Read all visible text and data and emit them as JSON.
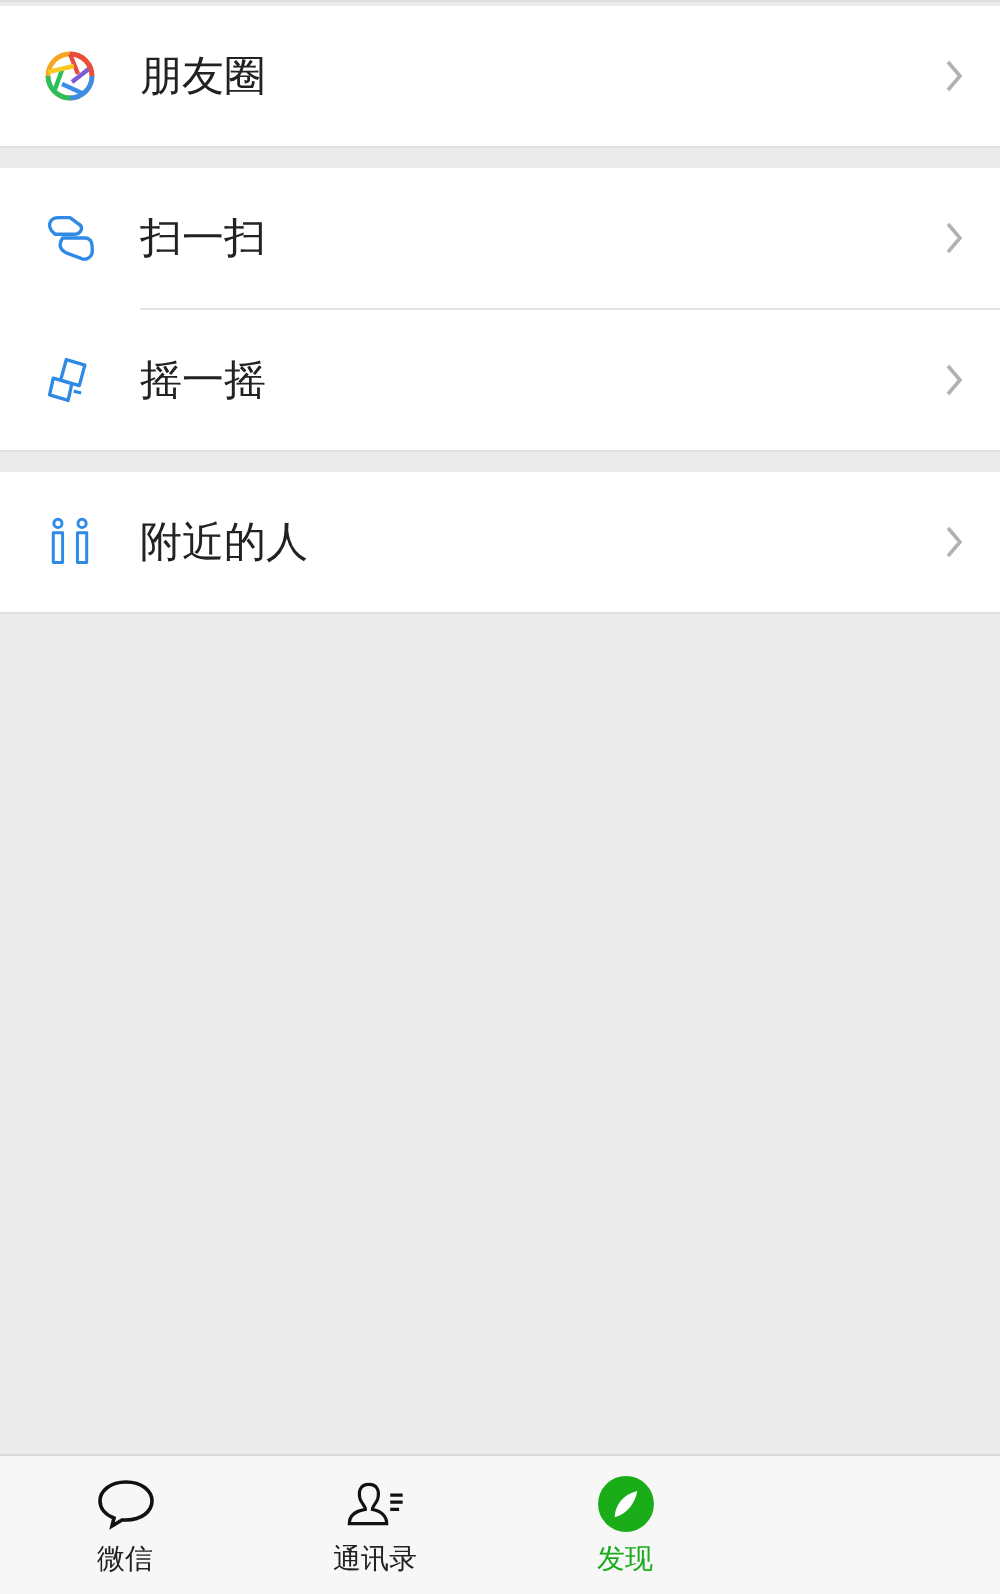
{
  "groups": [
    {
      "items": [
        {
          "label": "朋友圈"
        }
      ]
    },
    {
      "items": [
        {
          "label": "扫一扫"
        },
        {
          "label": "摇一摇"
        }
      ]
    },
    {
      "items": [
        {
          "label": "附近的人"
        }
      ]
    }
  ],
  "tab_bar": [
    {
      "label": "微信",
      "selected": false
    },
    {
      "label": "通讯录",
      "selected": false
    },
    {
      "label": "发现",
      "selected": true
    }
  ]
}
